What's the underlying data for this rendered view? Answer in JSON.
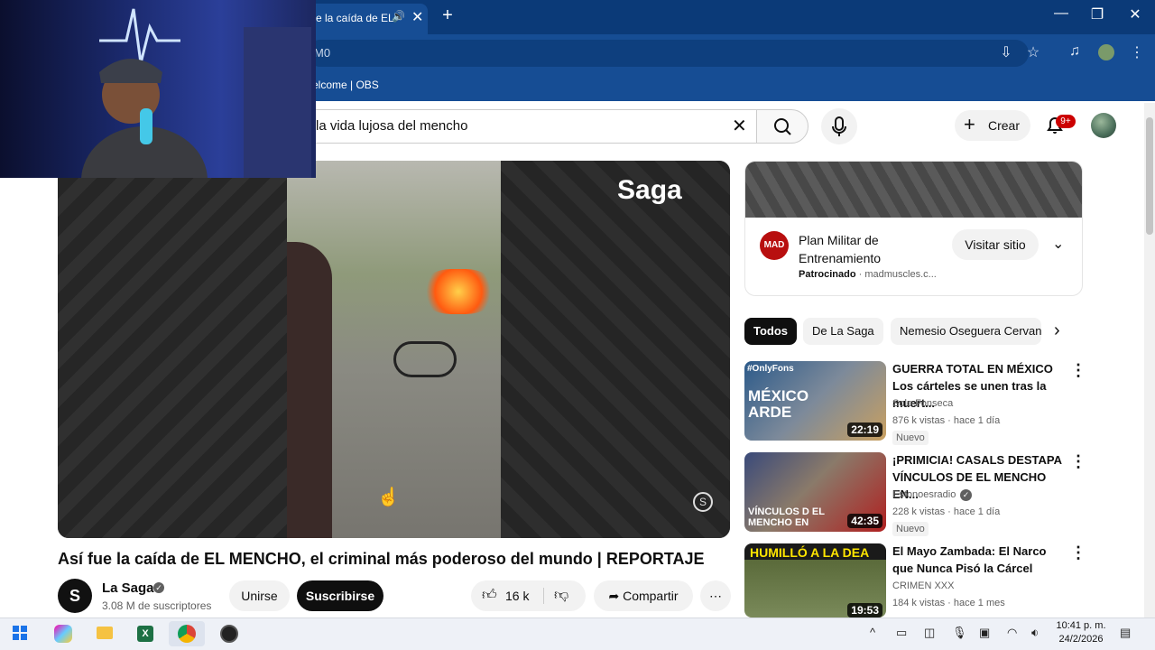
{
  "browser": {
    "tab_title": "e la caída de EL",
    "new_tab": "+",
    "address": "M0",
    "bookmark_obs": "elcome | OBS",
    "window_controls": [
      "minimize",
      "restore",
      "close"
    ]
  },
  "youtube": {
    "search_query": "la vida lujosa del mencho",
    "create_label": "Crear",
    "notif_badge": "9+"
  },
  "player": {
    "watermark": "Saga"
  },
  "video": {
    "title": "Así fue la caída de EL MENCHO, el criminal más poderoso del mundo | REPORTAJE",
    "channel": "La Saga",
    "subscribers": "3.08 M de suscriptores",
    "join_label": "Unirse",
    "subscribe_label": "Suscribirse",
    "likes": "16 k",
    "share_label": "Compartir"
  },
  "ad": {
    "title": "Plan Militar de Entrenamiento",
    "sponsored": "Patrocinado",
    "domain": "madmuscles.c...",
    "visit_label": "Visitar sitio",
    "logo_text": "MAD"
  },
  "chips": [
    "Todos",
    "De La Saga",
    "Nemesio Oseguera Cervantes"
  ],
  "related": [
    {
      "title": "GUERRA TOTAL EN MÉXICO Los cárteles se unen tras la muert...",
      "channel": "Solo Fonseca",
      "meta": "876 k vistas · hace 1 día",
      "badge": "Nuevo",
      "duration": "22:19",
      "thumb_tag": "#OnlyFons",
      "thumb_text": "MÉXICO ARDE"
    },
    {
      "title": "¡PRIMICIA! CASALS DESTAPA VÍNCULOS DE EL MENCHO EN...",
      "channel": "Estonoesradio",
      "meta": "228 k vistas · hace 1 día",
      "badge": "Nuevo",
      "duration": "42:35",
      "thumb_text": "VÍNCULOS D EL MENCHO EN"
    },
    {
      "title": "El Mayo Zambada: El Narco que Nunca Pisó la Cárcel",
      "channel": "CRIMEN XXX",
      "meta": "184 k vistas · hace 1 mes",
      "duration": "19:53",
      "thumb_text": "HUMILLÓ A LA DEA"
    }
  ],
  "taskbar": {
    "time": "10:41 p. m.",
    "date": "24/2/2026"
  }
}
